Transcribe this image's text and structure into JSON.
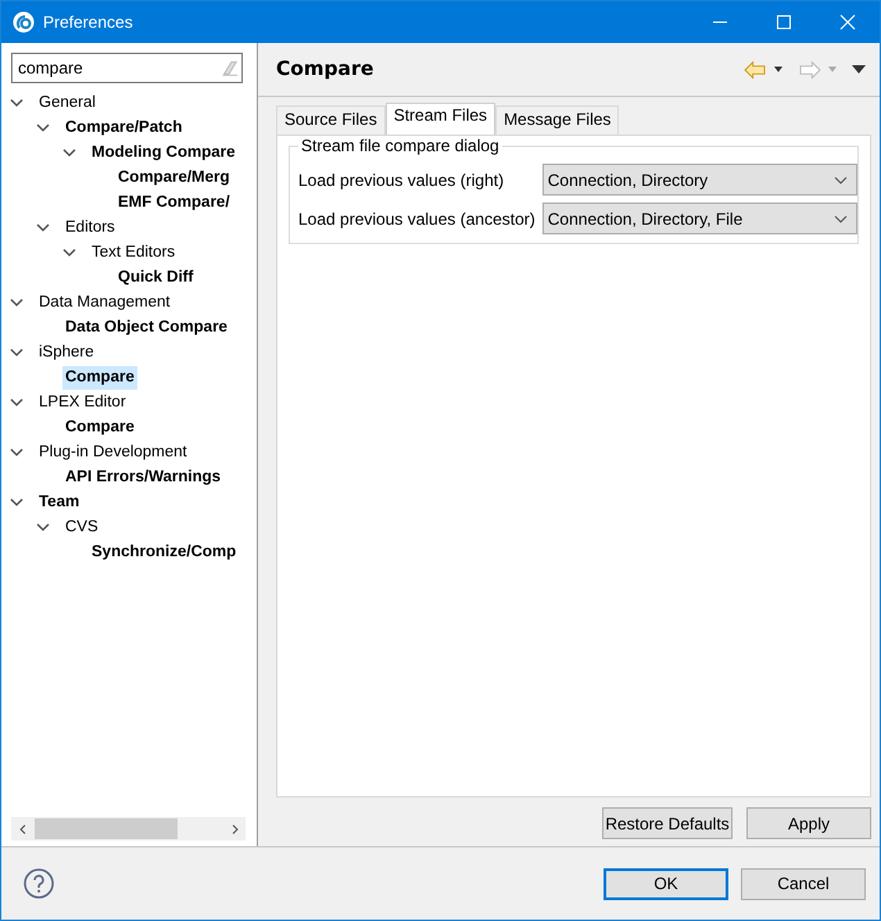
{
  "window": {
    "title": "Preferences"
  },
  "filter": {
    "value": "compare"
  },
  "tree": [
    {
      "label": "General",
      "matched": false,
      "selected": false,
      "expanded": true,
      "children": [
        {
          "label": "Compare/Patch",
          "matched": true,
          "selected": false,
          "expanded": true,
          "children": [
            {
              "label": "Modeling Compare",
              "matched": true,
              "selected": false,
              "expanded": true,
              "children": [
                {
                  "label": "Compare/Merg",
                  "matched": true,
                  "selected": false
                },
                {
                  "label": "EMF Compare/",
                  "matched": true,
                  "selected": false
                }
              ]
            }
          ]
        },
        {
          "label": "Editors",
          "matched": false,
          "selected": false,
          "expanded": true,
          "children": [
            {
              "label": "Text Editors",
              "matched": false,
              "selected": false,
              "expanded": true,
              "children": [
                {
                  "label": "Quick Diff",
                  "matched": true,
                  "selected": false
                }
              ]
            }
          ]
        }
      ]
    },
    {
      "label": "Data Management",
      "matched": false,
      "selected": false,
      "expanded": true,
      "children": [
        {
          "label": "Data Object Compare",
          "matched": true,
          "selected": false
        }
      ]
    },
    {
      "label": "iSphere",
      "matched": false,
      "selected": false,
      "expanded": true,
      "children": [
        {
          "label": "Compare",
          "matched": true,
          "selected": true
        }
      ]
    },
    {
      "label": "LPEX Editor",
      "matched": false,
      "selected": false,
      "expanded": true,
      "children": [
        {
          "label": "Compare",
          "matched": true,
          "selected": false
        }
      ]
    },
    {
      "label": "Plug-in Development",
      "matched": false,
      "selected": false,
      "expanded": true,
      "children": [
        {
          "label": "API Errors/Warnings",
          "matched": true,
          "selected": false
        }
      ]
    },
    {
      "label": "Team",
      "matched": true,
      "selected": false,
      "expanded": true,
      "children": [
        {
          "label": "CVS",
          "matched": false,
          "selected": false,
          "expanded": true,
          "children": [
            {
              "label": "Synchronize/Comp",
              "matched": true,
              "selected": false
            }
          ]
        }
      ]
    }
  ],
  "page": {
    "title": "Compare",
    "tabs": [
      {
        "label": "Source Files",
        "selected": false
      },
      {
        "label": "Stream Files",
        "selected": true
      },
      {
        "label": "Message Files",
        "selected": false
      }
    ],
    "group": {
      "title": "Stream file compare dialog",
      "rows": [
        {
          "label": "Load previous values (right)",
          "value": "Connection, Directory"
        },
        {
          "label": "Load previous values (ancestor)",
          "value": "Connection, Directory, File"
        }
      ]
    },
    "buttons": [
      "Restore Defaults",
      "Apply"
    ]
  },
  "dialog_buttons": [
    {
      "label": "OK",
      "default": true
    },
    {
      "label": "Cancel",
      "default": false
    }
  ]
}
